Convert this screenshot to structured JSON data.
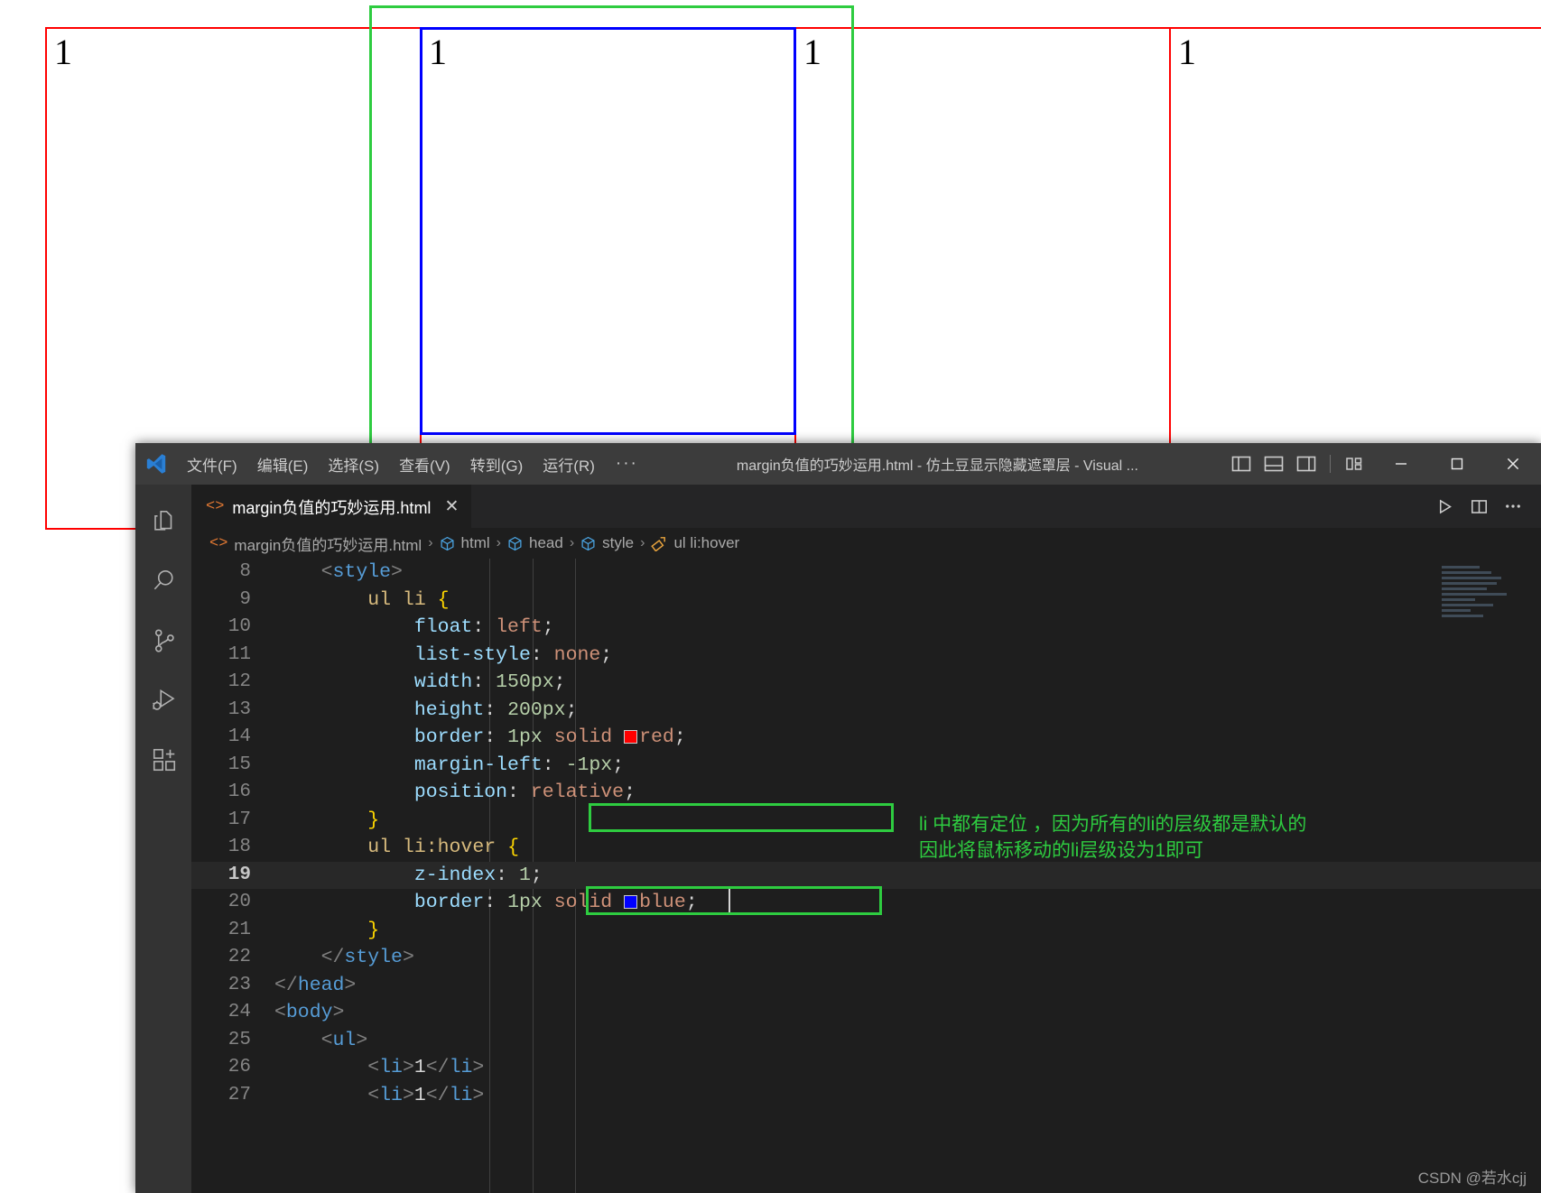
{
  "browser_preview": {
    "items": [
      {
        "label": "1",
        "border_color": "#ff0000"
      },
      {
        "label": "1",
        "border_color": "#ff0000"
      },
      {
        "label": "1",
        "border_color": "#ff0000"
      },
      {
        "label": "1",
        "border_color": "#ff0000"
      }
    ],
    "hover_border_color": "#0000ff",
    "annotation_color": "#2ecc40"
  },
  "titlebar": {
    "menus": [
      "文件(F)",
      "编辑(E)",
      "选择(S)",
      "查看(V)",
      "转到(G)",
      "运行(R)"
    ],
    "more_label": "···",
    "window_title": "margin负值的巧妙运用.html - 仿土豆显示隐藏遮罩层 - Visual ...",
    "layout_buttons": [
      "toggle-primary-sidebar",
      "toggle-panel",
      "toggle-secondary-sidebar",
      "customize-layout"
    ],
    "minimize_label": "─",
    "maximize_label": "□",
    "close_label": "✕"
  },
  "activitybar": {
    "items": [
      {
        "name": "explorer",
        "icon": "files-icon"
      },
      {
        "name": "search",
        "icon": "search-icon"
      },
      {
        "name": "source-control",
        "icon": "source-control-icon"
      },
      {
        "name": "run-and-debug",
        "icon": "debug-icon"
      },
      {
        "name": "extensions",
        "icon": "extensions-icon"
      }
    ]
  },
  "tabs": {
    "active": {
      "icon": "html-file-icon",
      "label": "margin负值的巧妙运用.html",
      "close": "✕"
    },
    "actions": [
      {
        "name": "run-file",
        "icon": "play-icon"
      },
      {
        "name": "split-editor",
        "icon": "split-editor-icon"
      },
      {
        "name": "more-actions",
        "icon": "ellipsis-icon"
      }
    ]
  },
  "breadcrumbs": [
    {
      "icon": "html-file-icon",
      "label": "margin负值的巧妙运用.html"
    },
    {
      "icon": "symbol-tag-icon",
      "label": "html"
    },
    {
      "icon": "symbol-tag-icon",
      "label": "head"
    },
    {
      "icon": "symbol-tag-icon",
      "label": "style"
    },
    {
      "icon": "symbol-ruler-icon",
      "label": "ul li:hover"
    }
  ],
  "editor": {
    "current_line": 19,
    "lines": [
      {
        "n": "8",
        "tokens": [
          {
            "t": "    ",
            "c": "t-txt"
          },
          {
            "t": "<",
            "c": "t-tagbr"
          },
          {
            "t": "style",
            "c": "t-tag"
          },
          {
            "t": ">",
            "c": "t-tagbr"
          }
        ]
      },
      {
        "n": "9",
        "tokens": [
          {
            "t": "        ",
            "c": "t-txt"
          },
          {
            "t": "ul li",
            "c": "t-sel"
          },
          {
            "t": " ",
            "c": "t-txt"
          },
          {
            "t": "{",
            "c": "t-brace"
          }
        ]
      },
      {
        "n": "10",
        "tokens": [
          {
            "t": "            ",
            "c": "t-txt"
          },
          {
            "t": "float",
            "c": "t-prop"
          },
          {
            "t": ": ",
            "c": "t-punc"
          },
          {
            "t": "left",
            "c": "t-val"
          },
          {
            "t": ";",
            "c": "t-punc"
          }
        ]
      },
      {
        "n": "11",
        "tokens": [
          {
            "t": "            ",
            "c": "t-txt"
          },
          {
            "t": "list-style",
            "c": "t-prop"
          },
          {
            "t": ": ",
            "c": "t-punc"
          },
          {
            "t": "none",
            "c": "t-val"
          },
          {
            "t": ";",
            "c": "t-punc"
          }
        ]
      },
      {
        "n": "12",
        "tokens": [
          {
            "t": "            ",
            "c": "t-txt"
          },
          {
            "t": "width",
            "c": "t-prop"
          },
          {
            "t": ": ",
            "c": "t-punc"
          },
          {
            "t": "150px",
            "c": "t-num"
          },
          {
            "t": ";",
            "c": "t-punc"
          }
        ]
      },
      {
        "n": "13",
        "tokens": [
          {
            "t": "            ",
            "c": "t-txt"
          },
          {
            "t": "height",
            "c": "t-prop"
          },
          {
            "t": ": ",
            "c": "t-punc"
          },
          {
            "t": "200px",
            "c": "t-num"
          },
          {
            "t": ";",
            "c": "t-punc"
          }
        ]
      },
      {
        "n": "14",
        "tokens": [
          {
            "t": "            ",
            "c": "t-txt"
          },
          {
            "t": "border",
            "c": "t-prop"
          },
          {
            "t": ": ",
            "c": "t-punc"
          },
          {
            "t": "1px",
            "c": "t-num"
          },
          {
            "t": " ",
            "c": "t-txt"
          },
          {
            "t": "solid",
            "c": "t-val"
          },
          {
            "t": " ",
            "c": "t-txt"
          },
          {
            "t": "@SWATCH:#ff0000",
            "c": "swatch"
          },
          {
            "t": "red",
            "c": "t-val"
          },
          {
            "t": ";",
            "c": "t-punc"
          }
        ]
      },
      {
        "n": "15",
        "tokens": [
          {
            "t": "            ",
            "c": "t-txt"
          },
          {
            "t": "margin-left",
            "c": "t-prop"
          },
          {
            "t": ": ",
            "c": "t-punc"
          },
          {
            "t": "-1px",
            "c": "t-num"
          },
          {
            "t": ";",
            "c": "t-punc"
          }
        ]
      },
      {
        "n": "16",
        "tokens": [
          {
            "t": "            ",
            "c": "t-txt"
          },
          {
            "t": "position",
            "c": "t-prop"
          },
          {
            "t": ": ",
            "c": "t-punc"
          },
          {
            "t": "relative",
            "c": "t-val"
          },
          {
            "t": ";",
            "c": "t-punc"
          }
        ]
      },
      {
        "n": "17",
        "tokens": [
          {
            "t": "        ",
            "c": "t-txt"
          },
          {
            "t": "}",
            "c": "t-brace"
          }
        ]
      },
      {
        "n": "18",
        "tokens": [
          {
            "t": "        ",
            "c": "t-txt"
          },
          {
            "t": "ul li:hover",
            "c": "t-sel"
          },
          {
            "t": " ",
            "c": "t-txt"
          },
          {
            "t": "{",
            "c": "t-brace"
          }
        ]
      },
      {
        "n": "19",
        "tokens": [
          {
            "t": "            ",
            "c": "t-txt"
          },
          {
            "t": "z-index",
            "c": "t-prop"
          },
          {
            "t": ": ",
            "c": "t-punc"
          },
          {
            "t": "1",
            "c": "t-num"
          },
          {
            "t": ";",
            "c": "t-punc"
          }
        ]
      },
      {
        "n": "20",
        "tokens": [
          {
            "t": "            ",
            "c": "t-txt"
          },
          {
            "t": "border",
            "c": "t-prop"
          },
          {
            "t": ": ",
            "c": "t-punc"
          },
          {
            "t": "1px",
            "c": "t-num"
          },
          {
            "t": " ",
            "c": "t-txt"
          },
          {
            "t": "solid",
            "c": "t-val"
          },
          {
            "t": " ",
            "c": "t-txt"
          },
          {
            "t": "@SWATCH:#0000ff",
            "c": "swatch"
          },
          {
            "t": "blue",
            "c": "t-val"
          },
          {
            "t": ";",
            "c": "t-punc"
          }
        ]
      },
      {
        "n": "21",
        "tokens": [
          {
            "t": "        ",
            "c": "t-txt"
          },
          {
            "t": "}",
            "c": "t-brace"
          }
        ]
      },
      {
        "n": "22",
        "tokens": [
          {
            "t": "    ",
            "c": "t-txt"
          },
          {
            "t": "</",
            "c": "t-tagbr"
          },
          {
            "t": "style",
            "c": "t-tag"
          },
          {
            "t": ">",
            "c": "t-tagbr"
          }
        ]
      },
      {
        "n": "23",
        "tokens": [
          {
            "t": "",
            "c": "t-txt"
          },
          {
            "t": "</",
            "c": "t-tagbr"
          },
          {
            "t": "head",
            "c": "t-tag"
          },
          {
            "t": ">",
            "c": "t-tagbr"
          }
        ]
      },
      {
        "n": "24",
        "tokens": [
          {
            "t": "",
            "c": "t-txt"
          },
          {
            "t": "<",
            "c": "t-tagbr"
          },
          {
            "t": "body",
            "c": "t-tag"
          },
          {
            "t": ">",
            "c": "t-tagbr"
          }
        ]
      },
      {
        "n": "25",
        "tokens": [
          {
            "t": "    ",
            "c": "t-txt"
          },
          {
            "t": "<",
            "c": "t-tagbr"
          },
          {
            "t": "ul",
            "c": "t-tag"
          },
          {
            "t": ">",
            "c": "t-tagbr"
          }
        ]
      },
      {
        "n": "26",
        "tokens": [
          {
            "t": "        ",
            "c": "t-txt"
          },
          {
            "t": "<",
            "c": "t-tagbr"
          },
          {
            "t": "li",
            "c": "t-tag"
          },
          {
            "t": ">",
            "c": "t-tagbr"
          },
          {
            "t": "1",
            "c": "t-txt"
          },
          {
            "t": "</",
            "c": "t-tagbr"
          },
          {
            "t": "li",
            "c": "t-tag"
          },
          {
            "t": ">",
            "c": "t-tagbr"
          }
        ]
      },
      {
        "n": "27",
        "tokens": [
          {
            "t": "        ",
            "c": "t-txt"
          },
          {
            "t": "<",
            "c": "t-tagbr"
          },
          {
            "t": "li",
            "c": "t-tag"
          },
          {
            "t": ">",
            "c": "t-tagbr"
          },
          {
            "t": "1",
            "c": "t-txt"
          },
          {
            "t": "</",
            "c": "t-tagbr"
          },
          {
            "t": "li",
            "c": "t-tag"
          },
          {
            "t": ">",
            "c": "t-tagbr"
          }
        ]
      }
    ]
  },
  "annotation": {
    "note": "li 中都有定位 ，因为所有的li的层级都是默认的\n因此将鼠标移动的li层级设为1即可",
    "color": "#2ecc40"
  },
  "watermark": "CSDN @若水cjj"
}
